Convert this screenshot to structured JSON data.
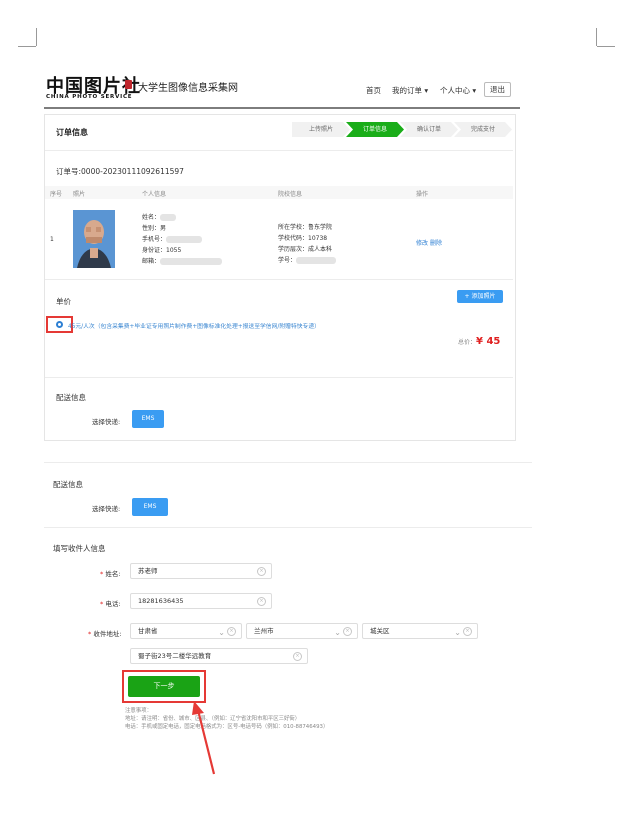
{
  "header": {
    "logo_text": "中国图片社",
    "logo_en": "CHINA PHOTO SERVICE",
    "site_name": "大学生图像信息采集网",
    "nav": {
      "home": "首页",
      "my_orders": "我的订单 ▾",
      "profile": "个人中心 ▾",
      "logout": "退出"
    }
  },
  "order_panel": {
    "title": "订单信息",
    "steps": [
      "上传照片",
      "订单信息",
      "确认订单",
      "完成支付"
    ],
    "active_step": 1,
    "order_no": "订单号:0000-20230111092611597",
    "table_headers": [
      "序号",
      "照片",
      "个人信息",
      "院校信息",
      "操作"
    ],
    "row": {
      "index": "1",
      "name_label": "姓名：",
      "gender": "性别：男",
      "phone_label": "手机号：",
      "id_card": "身份证：1055",
      "email_label": "邮箱：",
      "school": "所在学校：鲁东学院",
      "school_code": "学校代码：10738",
      "level": "学历层次：成人本科",
      "student_no_label": "学号：",
      "actions": {
        "edit": "修改",
        "delete": "删除"
      }
    },
    "unit_price_title": "单价",
    "add_photo_button": "+ 添加照片",
    "promo_text": "45元/人次（包含采集费+毕业证专用照片制作费+图像标准化处理+报送至学信网/附赠特快专递）",
    "total_label": "总价：",
    "total_value": "¥ 45",
    "delivery_title": "配送信息",
    "courier_label": "选择快递:",
    "courier_option": "EMS"
  },
  "form": {
    "delivery_title": "配送信息",
    "courier_label": "选择快递:",
    "courier_option": "EMS",
    "recipient_title": "填写收件人信息",
    "name_label": "姓名:",
    "name_value": "苏老师",
    "phone_label": "电话:",
    "phone_value": "18281636435",
    "address_label": "收件地址:",
    "province": "甘肃省",
    "city": "兰州市",
    "district": "城关区",
    "street": "蜀子街23号二楼华远教育",
    "next_button": "下一步",
    "notes": [
      "注意事项：",
      "地址：请注明：省份、城市、区县、（例如：辽宁省沈阳市和平区三好街）",
      "电话：手机或固定电话，固定电话格式为：区号-电话号码（例如：010-88746493）"
    ]
  },
  "colors": {
    "accent_green": "#1aad19",
    "accent_blue": "#3a9cf2",
    "price_red": "#e02020",
    "annotation_red": "#e53935"
  }
}
